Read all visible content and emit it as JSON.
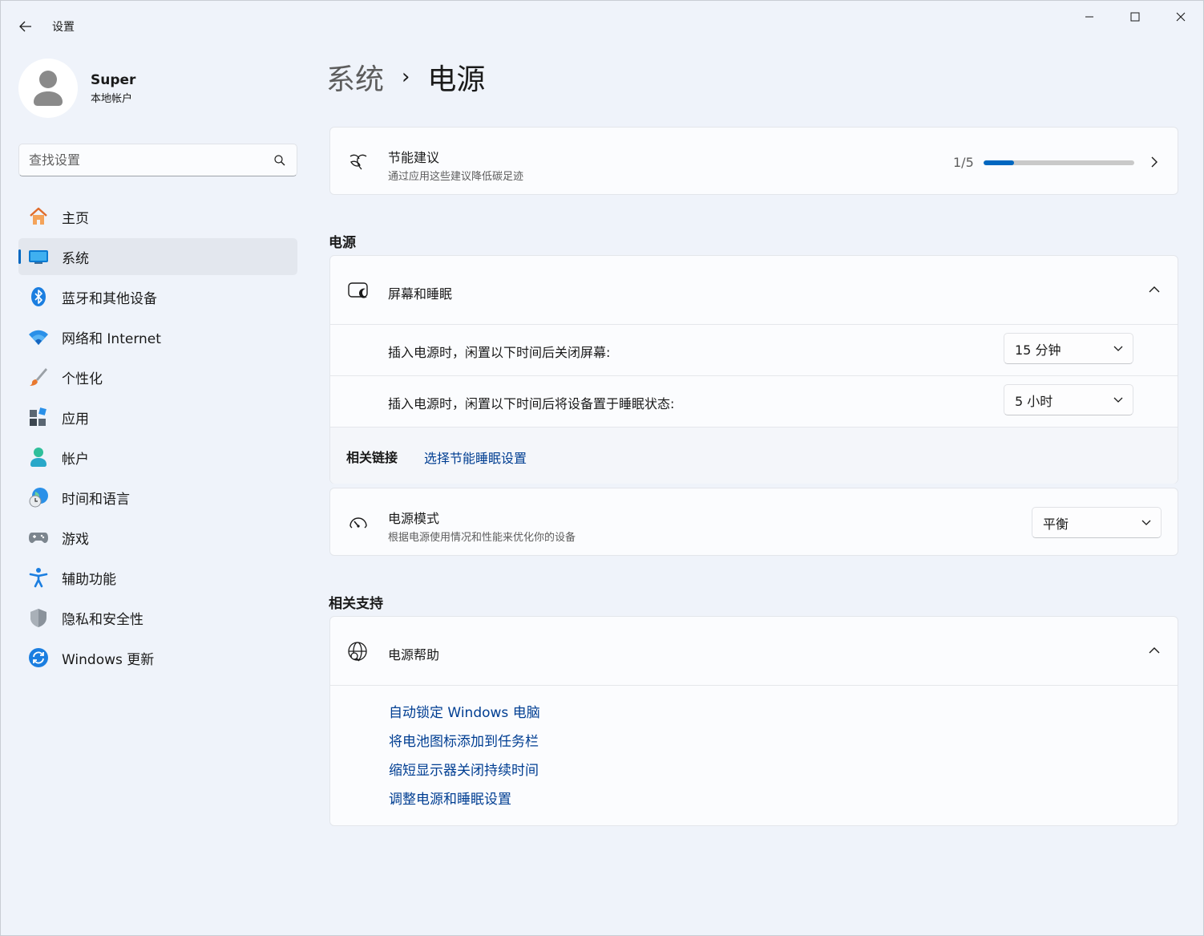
{
  "window": {
    "title": "设置",
    "controls": [
      "minimize",
      "maximize",
      "close"
    ]
  },
  "profile": {
    "name": "Super",
    "account_type": "本地帐户"
  },
  "search": {
    "placeholder": "查找设置"
  },
  "sidebar": {
    "items": [
      {
        "label": "主页",
        "icon": "home-icon",
        "active": false
      },
      {
        "label": "系统",
        "icon": "system-icon",
        "active": true
      },
      {
        "label": "蓝牙和其他设备",
        "icon": "bluetooth-icon",
        "active": false
      },
      {
        "label": "网络和 Internet",
        "icon": "wifi-icon",
        "active": false
      },
      {
        "label": "个性化",
        "icon": "brush-icon",
        "active": false
      },
      {
        "label": "应用",
        "icon": "apps-icon",
        "active": false
      },
      {
        "label": "帐户",
        "icon": "account-icon",
        "active": false
      },
      {
        "label": "时间和语言",
        "icon": "time-language-icon",
        "active": false
      },
      {
        "label": "游戏",
        "icon": "gamepad-icon",
        "active": false
      },
      {
        "label": "辅助功能",
        "icon": "accessibility-icon",
        "active": false
      },
      {
        "label": "隐私和安全性",
        "icon": "shield-icon",
        "active": false
      },
      {
        "label": "Windows 更新",
        "icon": "update-icon",
        "active": false
      }
    ]
  },
  "breadcrumb": {
    "parent": "系统",
    "separator": "›",
    "current": "电源"
  },
  "energy_card": {
    "title": "节能建议",
    "subtitle": "通过应用这些建议降低碳足迹",
    "progress_text": "1/5",
    "progress_fraction": 0.2
  },
  "power_section": {
    "label": "电源",
    "screen_sleep": {
      "title": "屏幕和睡眠",
      "rows": [
        {
          "label": "插入电源时，闲置以下时间后关闭屏幕:",
          "value": "15 分钟"
        },
        {
          "label": "插入电源时，闲置以下时间后将设备置于睡眠状态:",
          "value": "5 小时"
        }
      ],
      "related_title": "相关链接",
      "related_link": "选择节能睡眠设置"
    },
    "power_mode": {
      "title": "电源模式",
      "subtitle": "根据电源使用情况和性能来优化你的设备",
      "value": "平衡"
    }
  },
  "support_section": {
    "label": "相关支持",
    "help": {
      "title": "电源帮助",
      "links": [
        "自动锁定 Windows 电脑",
        "将电池图标添加到任务栏",
        "缩短显示器关闭持续时间",
        "调整电源和睡眠设置"
      ]
    }
  },
  "colors": {
    "accent": "#0067c0",
    "link": "#003e92",
    "background": "#eff3fa",
    "card": "#fbfcfe"
  }
}
